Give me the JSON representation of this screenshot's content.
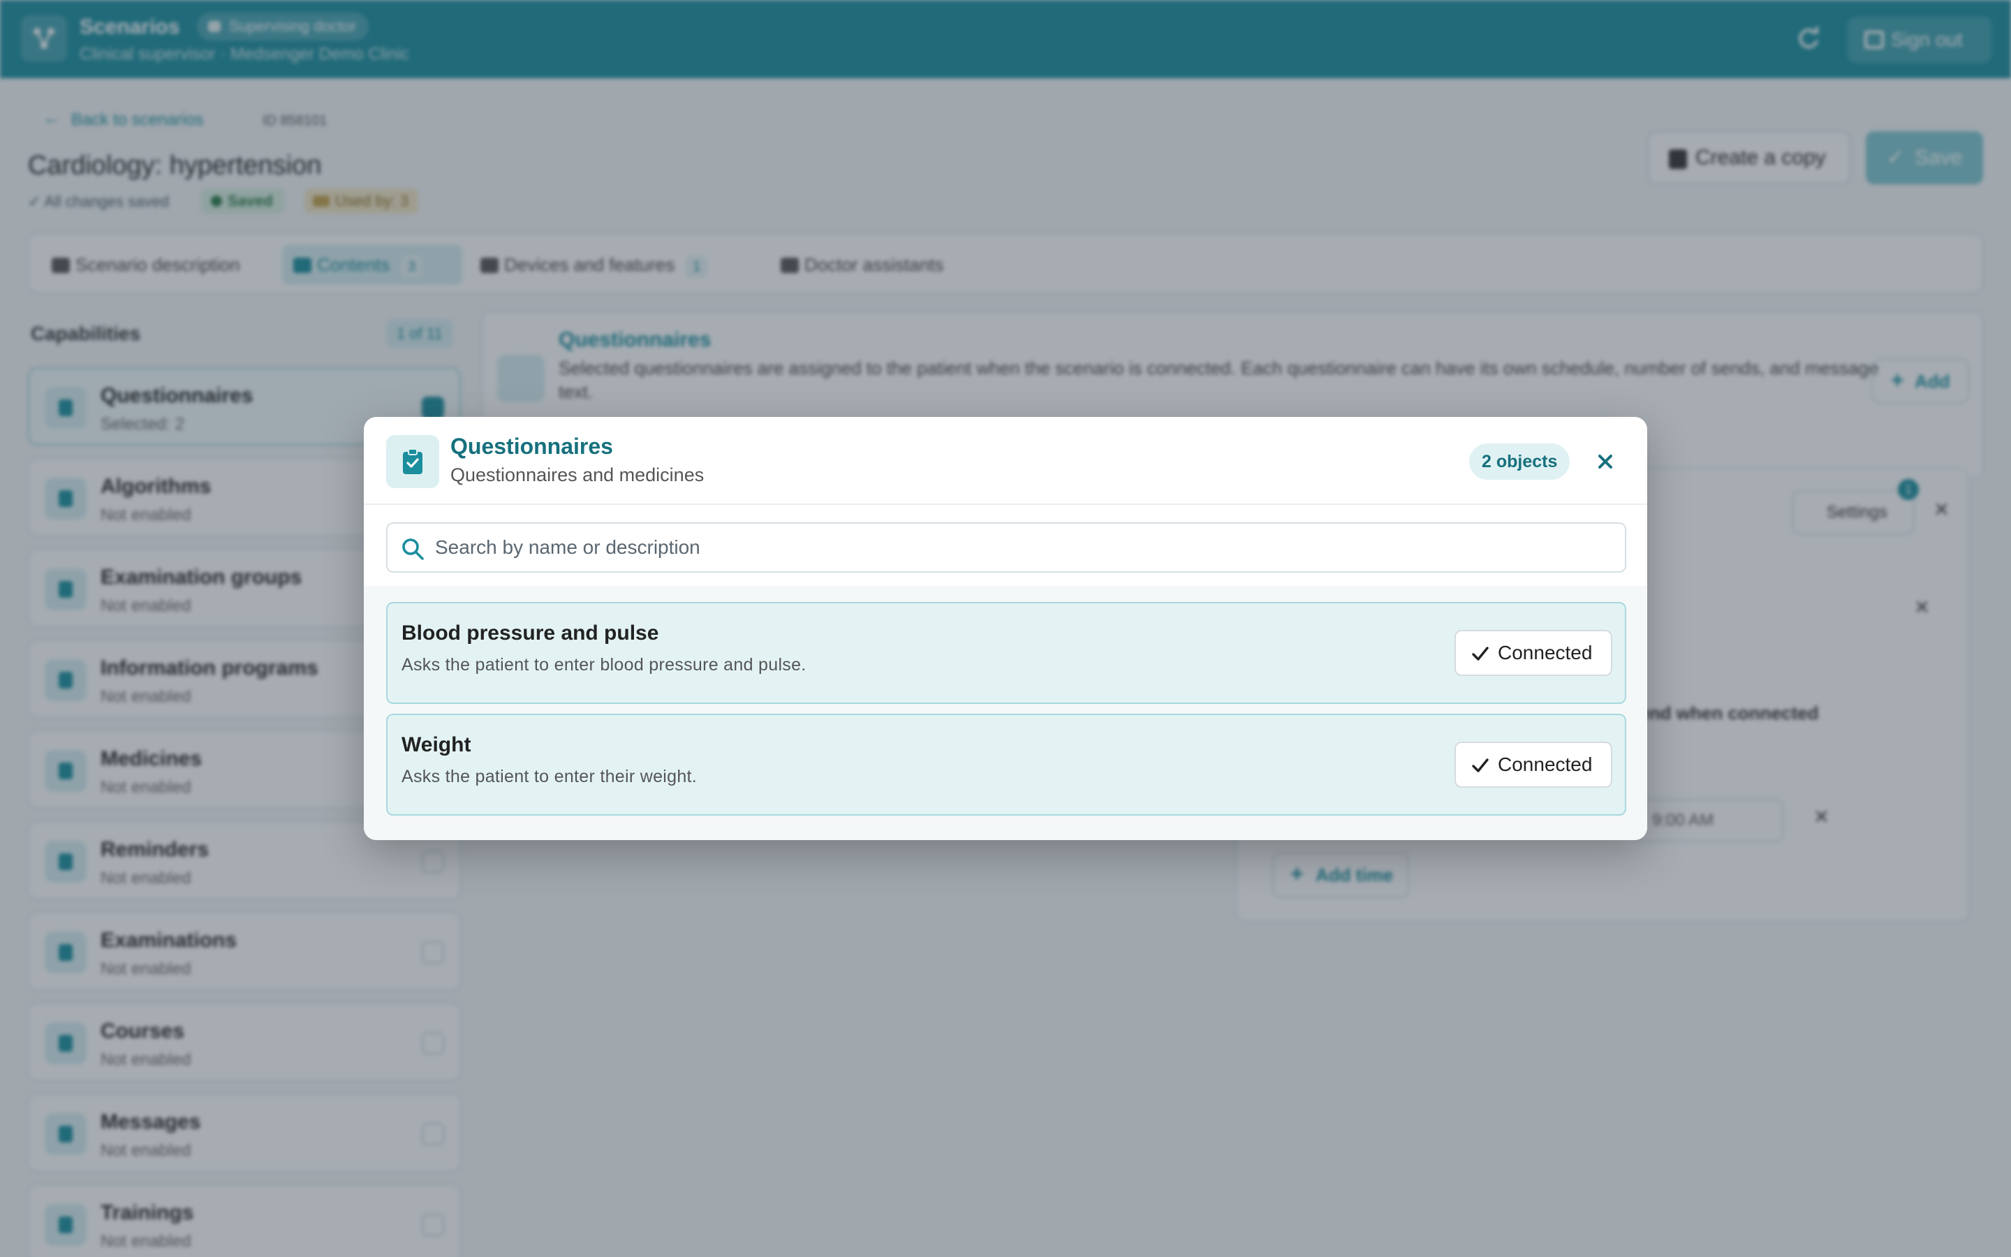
{
  "topbar": {
    "app_title": "Scenarios",
    "role_badge": "Supervising doctor",
    "subtitle": "Clinical supervisor · Medsenger Demo Clinic",
    "sign_out": "Sign out"
  },
  "page": {
    "back": "Back to scenarios",
    "id": "ID 858101",
    "title": "Cardiology: hypertension",
    "saved_note": "✓ All changes saved",
    "saved_chip": "Saved",
    "used_chip": "Used by: 3",
    "copy_button": "Create a copy",
    "save_button": "Save"
  },
  "tabs": [
    {
      "label": "Scenario description"
    },
    {
      "label": "Contents",
      "count": "3"
    },
    {
      "label": "Devices and features",
      "count": "1"
    },
    {
      "label": "Doctor assistants"
    }
  ],
  "capabilities": {
    "title": "Capabilities",
    "count": "1 of 11",
    "items": [
      {
        "name": "Questionnaires",
        "status": "Selected: 2"
      },
      {
        "name": "Algorithms",
        "status": "Not enabled"
      },
      {
        "name": "Examination groups",
        "status": "Not enabled"
      },
      {
        "name": "Information programs",
        "status": "Not enabled"
      },
      {
        "name": "Medicines",
        "status": "Not enabled"
      },
      {
        "name": "Reminders",
        "status": "Not enabled"
      },
      {
        "name": "Examinations",
        "status": "Not enabled"
      },
      {
        "name": "Courses",
        "status": "Not enabled"
      },
      {
        "name": "Messages",
        "status": "Not enabled"
      },
      {
        "name": "Trainings",
        "status": "Not enabled"
      }
    ]
  },
  "detail": {
    "title": "Questionnaires",
    "description": "Selected questionnaires are assigned to the patient when the scenario is connected. Each questionnaire can have its own schedule, number of sends, and message text.",
    "add_button": "Add",
    "settings_button": "Settings",
    "settings_badge": "1",
    "send_option": "Send when connected",
    "time_value": "9:00 AM",
    "add_time": "Add time"
  },
  "modal": {
    "title": "Questionnaires",
    "subtitle": "Questionnaires and medicines",
    "count_badge": "2 objects",
    "search_placeholder": "Search by name or description",
    "items": [
      {
        "name": "Blood pressure and pulse",
        "description": "Asks the patient to enter blood pressure and pulse.",
        "status_label": "Connected"
      },
      {
        "name": "Weight",
        "description": "Asks the patient to enter their weight.",
        "status_label": "Connected"
      }
    ]
  },
  "colors": {
    "brand": "#1b8e9e",
    "brand_dark": "#16707d",
    "item_bg": "#e3f3f4",
    "overlay": "rgba(44,58,72,0.42)"
  },
  "icons": {
    "logo": "network-icon",
    "modal_header": "clipboard-check-icon",
    "search": "search-icon",
    "close": "close-icon",
    "connected": "check-icon"
  }
}
